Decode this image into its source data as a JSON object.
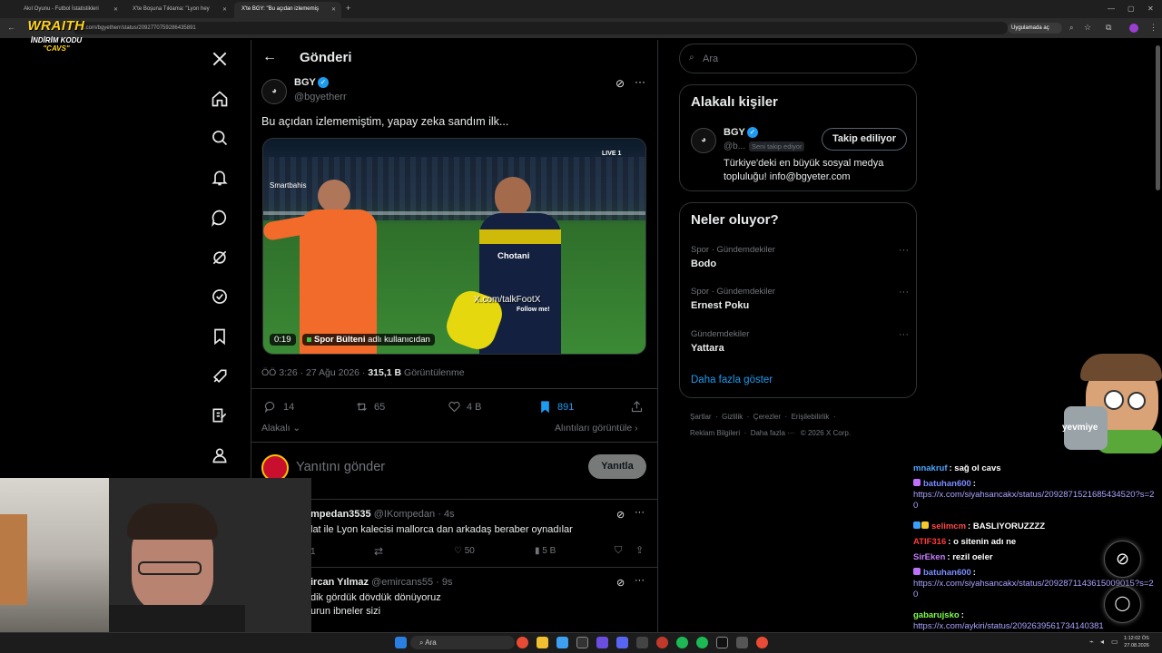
{
  "browser": {
    "tabs": [
      {
        "label": "Akıl Oyunu - Futbol İstatistikleri"
      },
      {
        "label": "X'te Boşuna Tıklama: \"Lyon hey"
      },
      {
        "label": "X'te BGY: \"Bu açıdan izlememiş"
      }
    ],
    "url": "x.com/bgyetherr/status/2092770759286435891",
    "app_button": "Uygulamada aç"
  },
  "overlay": {
    "title": "WRAITH",
    "line1": "İNDİRİM KODU",
    "line2": "\"CAVS\""
  },
  "header": {
    "title": "Gönderi"
  },
  "post": {
    "author_name": "BGY",
    "author_handle": "@bgyetherr",
    "text": "Bu açıdan izlememiştim, yapay zeka sandım ilk...",
    "video": {
      "live_badge": "LIVE 1",
      "sponsor": "Smartbahis",
      "watermark": "X.com/talkFootX",
      "watermark2": "Follow me!",
      "jersey": "Chotani",
      "duration": "0:19",
      "source_name": "Spor Bülteni",
      "source_suffix": "adlı kullanıcıdan"
    },
    "meta_time": "ÖÖ 3:26 · 27 Ağu 2026 · ",
    "views_count": "315,1 B",
    "views_label": " Görüntülenme",
    "replies": "14",
    "reposts": "65",
    "likes": "4 B",
    "bookmarks": "891",
    "sort_label": "Alakalı",
    "quotes_label": "Alıntıları görüntüle"
  },
  "composer": {
    "placeholder": "Yanıtını gönder",
    "button": "Yanıtla"
  },
  "replies": [
    {
      "name": "mpedan3535",
      "handle": "@IKompedan",
      "time": "· 4s",
      "text": "lat ile Lyon kalecisi mallorca dan arkadaş beraber oynadılar",
      "replies": "1",
      "likes": "50",
      "views": "5 B"
    },
    {
      "name": "ircan Yılmaz",
      "handle": "@emircans55",
      "time": "· 9s",
      "text_line1": "dik gördük dövdük dönüyoruz",
      "text_line2": "urun ibneler sizi"
    }
  ],
  "search": {
    "placeholder": "Ara"
  },
  "related": {
    "title": "Alakalı kişiler",
    "name": "BGY",
    "handle": "@b...",
    "follows_you": "Seni takip ediyor",
    "follow_button": "Takip ediliyor",
    "bio": "Türkiye'deki en büyük sosyal medya topluluğu! info@bgyeter.com"
  },
  "trends": {
    "title": "Neler oluyor?",
    "items": [
      {
        "category": "Spor · Gündemdekiler",
        "name": "Bodo"
      },
      {
        "category": "Spor · Gündemdekiler",
        "name": "Ernest Poku"
      },
      {
        "category": "Gündemdekiler",
        "name": "Yattara"
      }
    ],
    "more": "Daha fazla göster"
  },
  "footer": {
    "row1": [
      "Şartlar",
      "Gizlilik",
      "Çerezler",
      "Erişilebilirlik"
    ],
    "row2": [
      "Reklam Bilgileri",
      "Daha fazla ···",
      "© 2026 X Corp."
    ]
  },
  "mascot_label": "yevmiye",
  "chat": [
    {
      "user": "mnakruf",
      "text": ": sağ ol cavs",
      "color": "#4aa8ff"
    },
    {
      "user": "batuhan600",
      "text": ":",
      "link": "https://x.com/siyahsancakx/status/2092871521685434520?s=20",
      "color": "#7b8cff"
    },
    {
      "user": "selimcm",
      "text": ": BASLIYORUZZZZ",
      "color": "#ff4a4a"
    },
    {
      "user": "ATIF316",
      "text": ": o sitenin adı ne",
      "color": "#ff3b3b"
    },
    {
      "user": "SirEken",
      "text": ": rezil oeler",
      "color": "#c77dff"
    },
    {
      "user": "batuhan600",
      "text": ":",
      "link": "https://x.com/siyahsancakx/status/2092871143615009015?s=20",
      "color": "#7b8cff"
    },
    {
      "user": "gabarujsko",
      "text": ":",
      "link": "https://x.com/aykiri/status/2092639561734140381",
      "color": "#7fff4a"
    }
  ],
  "taskbar": {
    "search": "Ara",
    "time": "1:12:02 ÖS",
    "date": "27.08.2026"
  }
}
